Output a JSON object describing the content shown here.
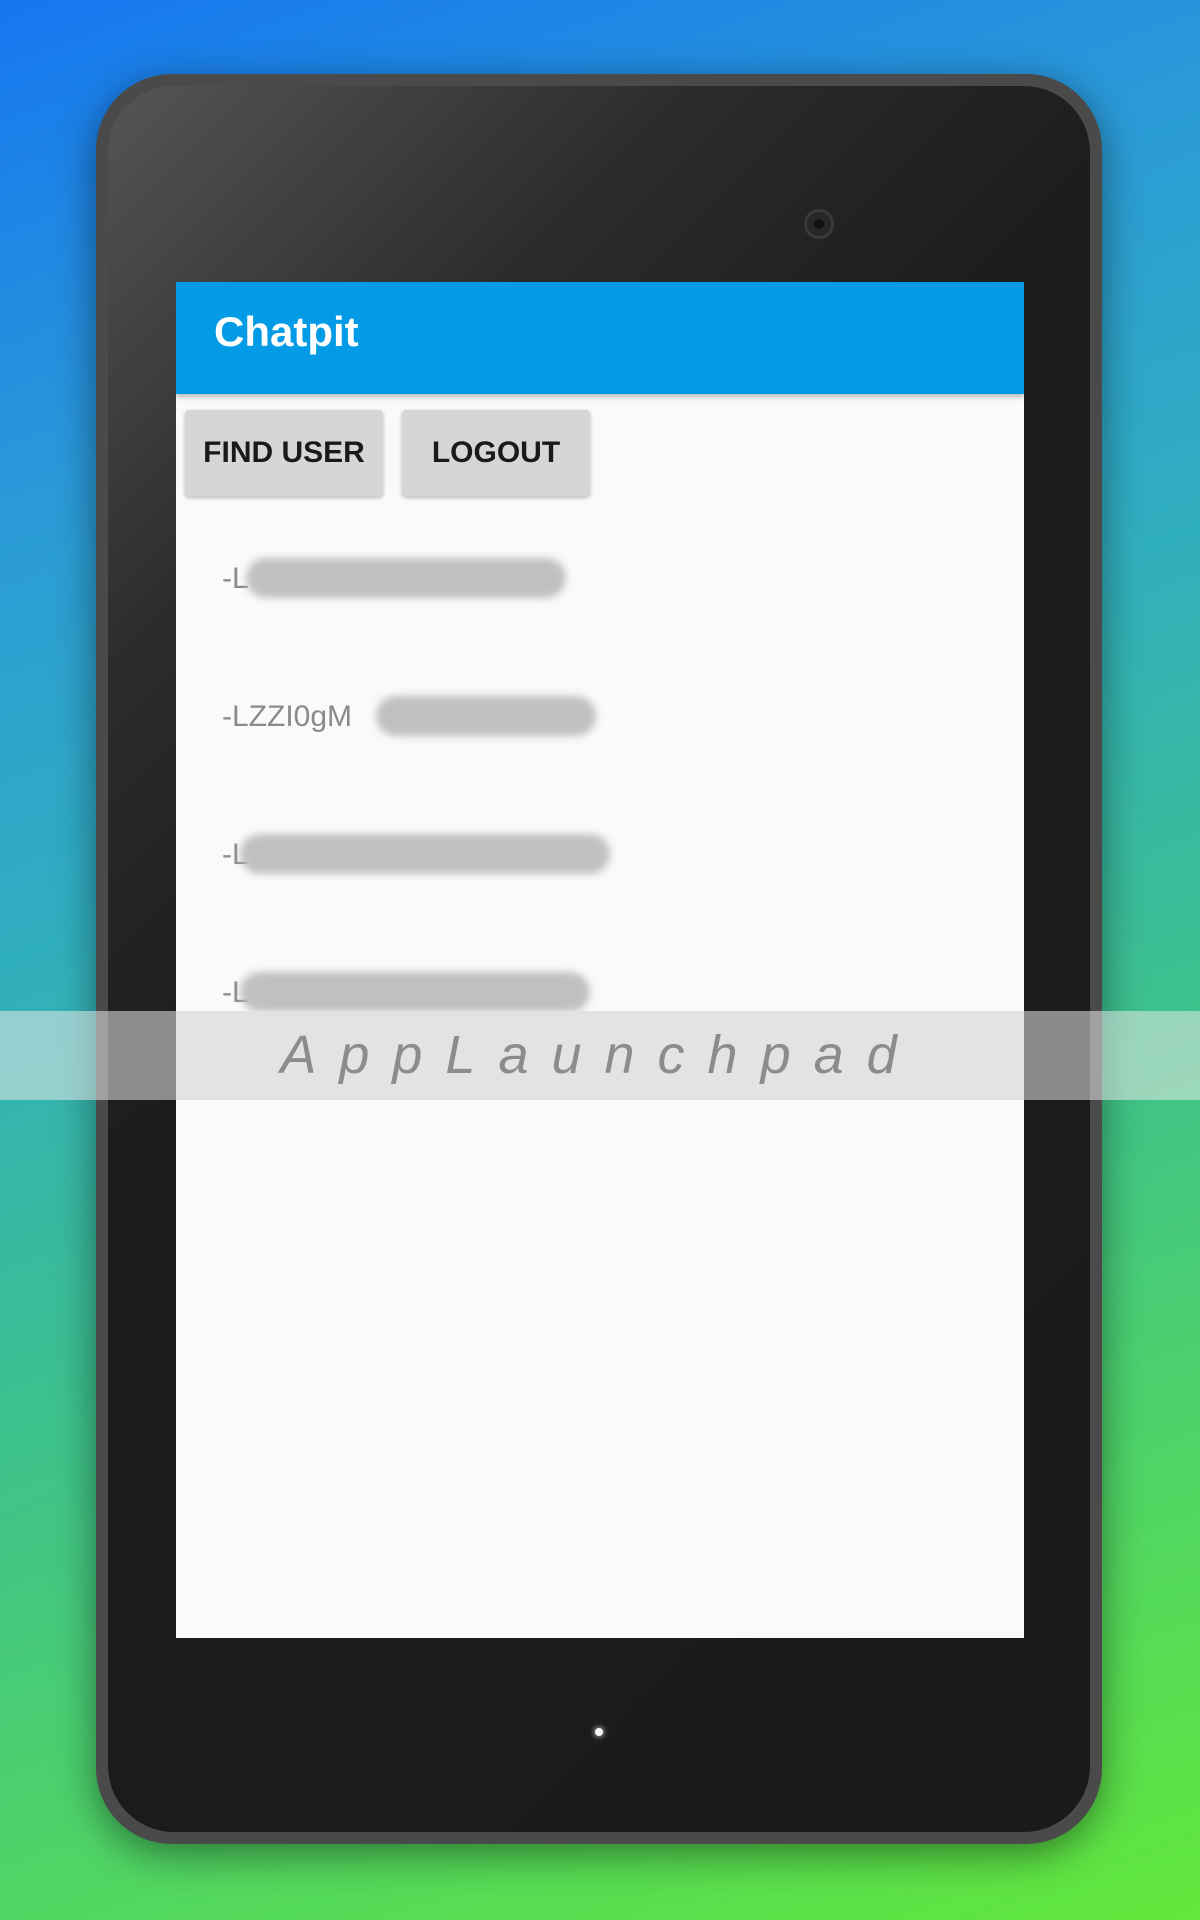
{
  "app": {
    "title": "Chatpit"
  },
  "toolbar": {
    "find_user_label": "FIND USER",
    "logout_label": "LOGOUT"
  },
  "users": [
    {
      "id": "-L"
    },
    {
      "id": "-LZZI0gM"
    },
    {
      "id": "-L"
    },
    {
      "id": "-L"
    }
  ],
  "watermark": {
    "text": "AppLaunchpad"
  },
  "colors": {
    "app_bar": "#039be5",
    "button": "#d6d6d6",
    "screen_bg": "#fafafa"
  }
}
